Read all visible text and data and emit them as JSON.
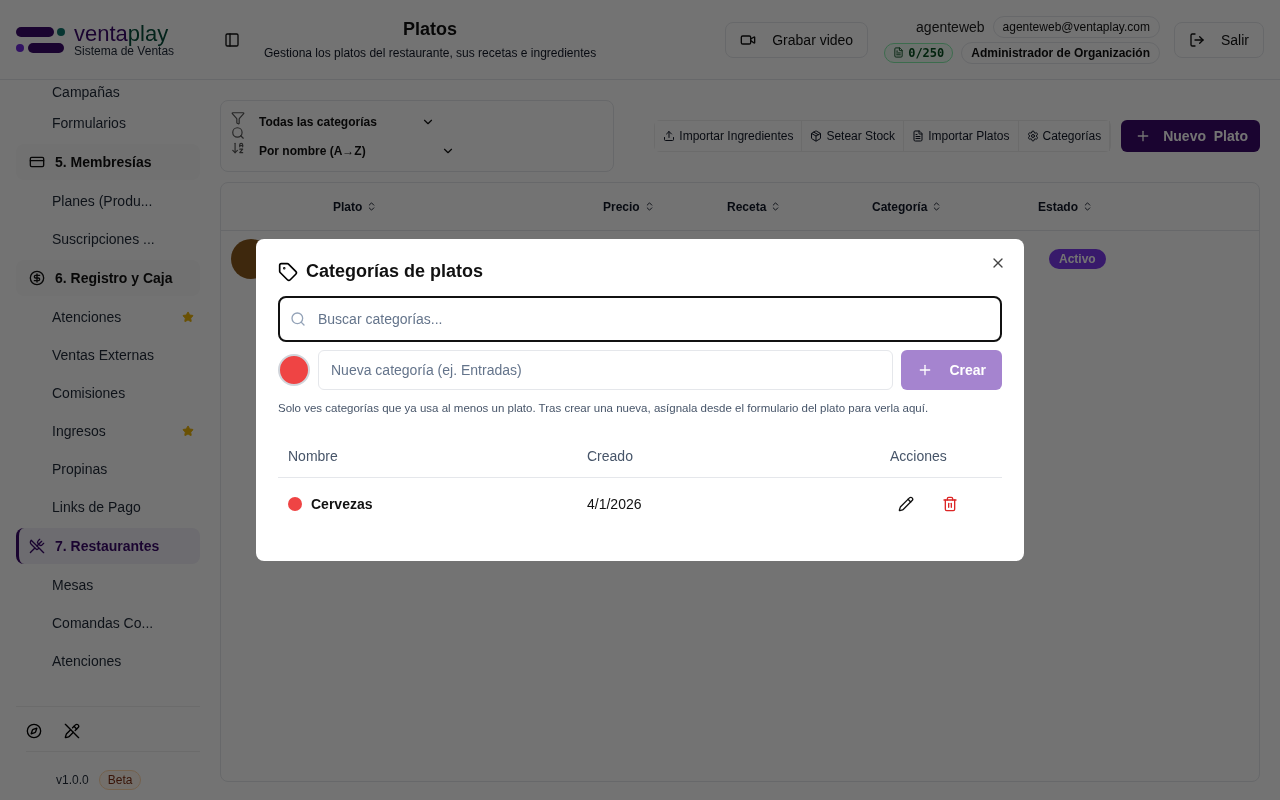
{
  "brand": {
    "name_first": "venta",
    "name_second": "play",
    "subtitle": "Sistema de Ventas"
  },
  "header": {
    "title": "Platos",
    "subtitle": "Gestiona los platos del restaurante, sus recetas e ingredientes",
    "record_button": "Grabar video",
    "user": {
      "name": "agenteweb",
      "email": "agenteweb@ventaplay.com",
      "quota": "0/250",
      "role": "Administrador de Organización"
    },
    "logout_button": "Salir"
  },
  "sidebar": {
    "items": [
      {
        "kind": "link",
        "label": "Campañas",
        "selected": false,
        "starred": false
      },
      {
        "kind": "link",
        "label": "Formularios",
        "selected": false,
        "starred": false
      },
      {
        "kind": "section",
        "label": "5. Membresías",
        "selected": false,
        "starred": false
      },
      {
        "kind": "link",
        "label": "Planes (Produ...",
        "selected": false,
        "starred": false
      },
      {
        "kind": "link",
        "label": "Suscripciones ...",
        "selected": false,
        "starred": false
      },
      {
        "kind": "section",
        "label": "6. Registro y Caja",
        "selected": false,
        "starred": false
      },
      {
        "kind": "link",
        "label": "Atenciones",
        "selected": false,
        "starred": true
      },
      {
        "kind": "link",
        "label": "Ventas Externas",
        "selected": false,
        "starred": false
      },
      {
        "kind": "link",
        "label": "Comisiones",
        "selected": false,
        "starred": false
      },
      {
        "kind": "link",
        "label": "Ingresos",
        "selected": false,
        "starred": true
      },
      {
        "kind": "link",
        "label": "Propinas",
        "selected": false,
        "starred": false
      },
      {
        "kind": "link",
        "label": "Links de Pago",
        "selected": false,
        "starred": false
      },
      {
        "kind": "section",
        "label": "7. Restaurantes",
        "selected": true,
        "starred": false
      },
      {
        "kind": "link",
        "label": "Mesas",
        "selected": false,
        "starred": false
      },
      {
        "kind": "link",
        "label": "Comandas Co...",
        "selected": false,
        "starred": false
      },
      {
        "kind": "link",
        "label": "Atenciones",
        "selected": false,
        "starred": false
      }
    ],
    "version": "v1.0.0",
    "badge": "Beta"
  },
  "toolbar": {
    "category_filter": "Todas las categorías",
    "sort": "Por nombre (A→Z)",
    "actions": [
      "Importar Ingredientes",
      "Setear Stock",
      "Importar Platos",
      "Categorías"
    ],
    "primary_button": "Nuevo  Plato"
  },
  "table": {
    "columns": [
      "Plato",
      "Precio",
      "Receta",
      "Categoría",
      "Estado"
    ],
    "rows": [
      {
        "status": "Activo"
      }
    ]
  },
  "modal": {
    "title": "Categorías de platos",
    "search_placeholder": "Buscar categorías...",
    "new_placeholder": "Nueva categoría (ej. Entradas)",
    "create_button": "Crear",
    "note": "Solo ves categorías que ya usa al menos un plato. Tras crear una nueva, asígnala desde el formulario del plato para verla aquí.",
    "columns": [
      "Nombre",
      "Creado",
      "Acciones"
    ],
    "rows": [
      {
        "name": "Cervezas",
        "color": "#ef4444",
        "created": "4/1/2026"
      }
    ]
  }
}
